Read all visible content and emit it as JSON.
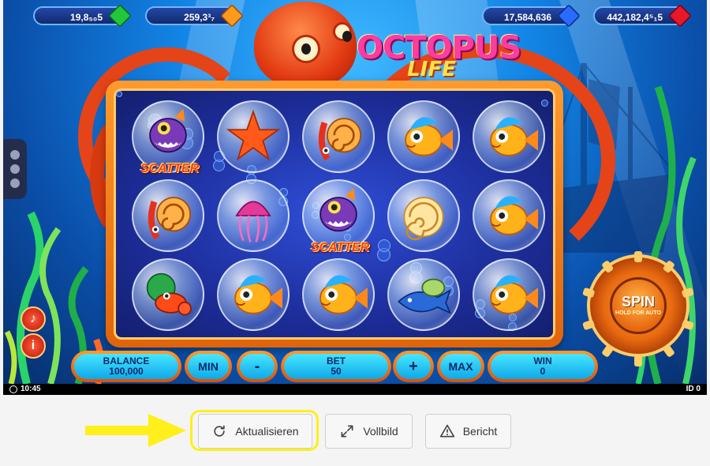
{
  "currencies": [
    {
      "value": "19,8₅₀5",
      "gem": "green"
    },
    {
      "value": "259,3³₇",
      "gem": "orange"
    },
    {
      "value": "17,584,636",
      "gem": "blue"
    },
    {
      "value": "442,182,4⁵₁5",
      "gem": "red"
    }
  ],
  "logo": {
    "line1": "OCTOPUS",
    "line2": "LIFE"
  },
  "reels": [
    [
      "scatter-fish",
      "starfish",
      "squid-nautilus",
      "orange-fish",
      "orange-fish"
    ],
    [
      "squid-nautilus",
      "jellyfish",
      "scatter-fish",
      "nautilus-shell",
      "orange-fish"
    ],
    [
      "hermit-crab",
      "orange-fish",
      "orange-fish",
      "shark-turtle",
      "orange-fish"
    ]
  ],
  "scatter_label": "SCATTER",
  "controls": {
    "balance_label": "BALANCE",
    "balance_value": "100,000",
    "min_label": "MIN",
    "minus_label": "-",
    "bet_label": "BET",
    "bet_value": "50",
    "plus_label": "+",
    "max_label": "MAX",
    "win_label": "WIN",
    "win_value": "0"
  },
  "spin": {
    "label": "SPIN",
    "sublabel": "HOLD FOR AUTO"
  },
  "status": {
    "time": "10:45",
    "id": "ID 0"
  },
  "side_buttons": {
    "sound": "♪",
    "info": "i"
  },
  "page_buttons": {
    "refresh": "Aktualisieren",
    "fullscreen": "Vollbild",
    "report": "Bericht"
  },
  "colors": {
    "highlight": "#ffef1a",
    "arrow": "#ffef1a"
  }
}
